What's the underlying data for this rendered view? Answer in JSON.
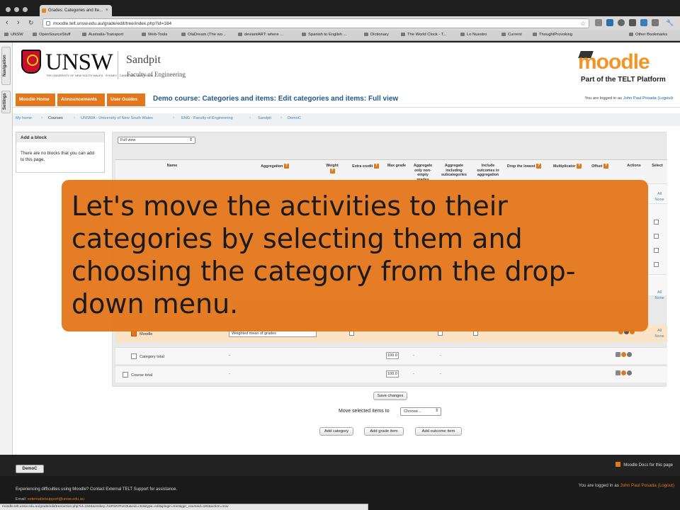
{
  "browser": {
    "tab_title": "Grades: Categories and Ite...",
    "url": "moodle.telt.unsw.edu.au/grade/edit/tree/index.php?id=184",
    "bookmarks": [
      "UNSW",
      "OpenSourceStuff",
      "Australia-Transport",
      "Web-Tools",
      "OlaDream (The wo...",
      "deviantART: where ...",
      "Spanish to English ...",
      "Dictionary",
      "The World Clock - T...",
      "Lo Nuestro",
      "Current",
      "ThoughtProvoking",
      "Other Bookmarks"
    ]
  },
  "dock": {
    "navigation": "Navigation",
    "settings": "Settings"
  },
  "header": {
    "unsw_wordmark": "UNSW",
    "unsw_tagline": "THE UNIVERSITY OF NEW SOUTH WALES · SYDNEY · CANBERRA · AUSTRALIA",
    "site_name": "Sandpit",
    "site_subtitle": "Faculty of Engineering",
    "moodle_logo": "moodle",
    "platform_caption": "Part of the TELT Platform"
  },
  "navbar": {
    "tabs": [
      "Moodle Home",
      "Announcements",
      "User Guides"
    ],
    "page_heading": "Demo course: Categories and items: Edit categories and items: Full view",
    "logged_in_prefix": "You are logged in as",
    "user_name": "John Paul Posada",
    "logout": "(Logout)"
  },
  "breadcrumb": [
    "My home",
    "Courses",
    "UNSWA - University of New South Wales",
    "ENG - Faculty of Engineering",
    "Sandpit",
    "DemoC"
  ],
  "block": {
    "title": "Add a block",
    "text": "There are no blocks that you can add to this page."
  },
  "grade_table": {
    "view_select": "Full view",
    "headers": {
      "name": "Name",
      "aggregation": "Aggregation",
      "weight": "Weight",
      "extra_credit": "Extra credit",
      "max_grade": "Max grade",
      "agg_non_empty": "Aggregate only non-empty grades",
      "agg_subcategories": "Aggregate including subcategories",
      "include_outcomes": "Include outcomes in aggregation",
      "drop_lowest": "Drop the lowest",
      "multiplicator": "Multiplicator",
      "offset": "Offset",
      "actions": "Actions",
      "select": "Select"
    },
    "select_all_none": [
      "All",
      "None"
    ],
    "moodle_row": {
      "name": "Moodle",
      "aggregation": "Weighted mean of grades"
    },
    "category_total": {
      "name": "Category total",
      "aggregation": "-",
      "max_grade": "100.0",
      "dash": "-"
    },
    "course_total": {
      "name": "Course total",
      "aggregation": "-",
      "max_grade": "100.0",
      "dash": "-"
    }
  },
  "overlay": {
    "caption": "Let's move the activities to their categories by selecting them and choosing the category from the drop-down menu."
  },
  "controls": {
    "save_changes": "Save changes",
    "move_label": "Move selected items to",
    "move_select": "Choose...",
    "add_category": "Add category",
    "add_grade_item": "Add grade item",
    "add_outcome_item": "Add outcome item"
  },
  "footer": {
    "course_button": "DemoC",
    "docs_link": "Moodle Docs for this page",
    "support_text": "Experiencing difficulties using Moodle? Contact External TELT Support for assistance.",
    "email_label": "Email:",
    "email_value": "externaltelsupport@unsw.edu.au",
    "logged_in_prefix": "You are logged in as",
    "user_name": "John Paul Posada",
    "logout": "(Logout)"
  },
  "status_bar": "moodle.telt.unsw.edu.au/grade/edit/tree/action.php?id=184&sesskey=hURWVRxN3u&eid=c63&type=edit&plugin=tree&gpr_courseid=184&action=mov"
}
